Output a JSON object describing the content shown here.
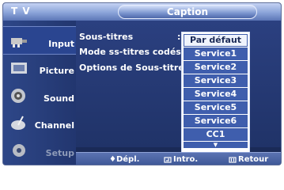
{
  "header": {
    "tv_label": "T V",
    "caption_label": "Caption"
  },
  "sidebar": {
    "items": [
      {
        "label": "Input",
        "icon": "input-plug-icon"
      },
      {
        "label": "Picture",
        "icon": "picture-icon"
      },
      {
        "label": "Sound",
        "icon": "sound-icon"
      },
      {
        "label": "Channel",
        "icon": "channel-icon"
      },
      {
        "label": "Setup",
        "icon": "setup-icon"
      }
    ]
  },
  "settings": {
    "subtitles_label": "Sous-titres",
    "mode_label": "Mode ss-titres codés",
    "options_label": "Options de Sous-titre",
    "colon": ":"
  },
  "dropdown": {
    "options": [
      "Par défaut",
      "Service1",
      "Service2",
      "Service3",
      "Service4",
      "Service5",
      "Service6",
      "CC1"
    ],
    "more_indicator": "▼"
  },
  "footer": {
    "move": "♦Dépl.",
    "enter": "Intro.",
    "return": "Retour"
  }
}
